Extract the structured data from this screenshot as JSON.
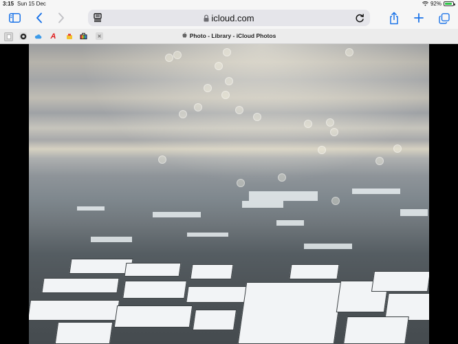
{
  "status": {
    "time": "3:15",
    "date": "Sun 15 Dec",
    "battery": "92%",
    "battery_level": 0.92
  },
  "toolbar": {
    "url": "icloud.com",
    "icons": {
      "sidebar": "sidebar-icon",
      "back": "back-chevron-icon",
      "forward": "forward-chevron-icon",
      "reader": "reader-mode-icon",
      "reload": "reload-icon",
      "share": "share-icon",
      "new_tab": "plus-icon",
      "tabs": "tabs-overview-icon"
    }
  },
  "tab": {
    "title": "Photo - Library - iCloud Photos"
  },
  "favorites": [
    {
      "name": "favicon-grey-doc",
      "glyph": "",
      "color": "#d8d8d8"
    },
    {
      "name": "favicon-dark-circle",
      "glyph": "",
      "color": "#3a3a3a"
    },
    {
      "name": "favicon-blue-cloud",
      "glyph": "",
      "color": "#ffffff"
    },
    {
      "name": "favicon-red-a",
      "glyph": "A",
      "color": "#ffffff"
    },
    {
      "name": "favicon-colorful",
      "glyph": "",
      "color": "#ffffff"
    },
    {
      "name": "favicon-multicolor",
      "glyph": "",
      "color": "#ffffff"
    },
    {
      "name": "favicon-close-box",
      "glyph": "✕",
      "color": "#9a9a9a"
    }
  ],
  "colors": {
    "accent": "#1a73e8",
    "toolbar_bg": "#f6f6f6",
    "battery_green": "#2fc94a"
  }
}
